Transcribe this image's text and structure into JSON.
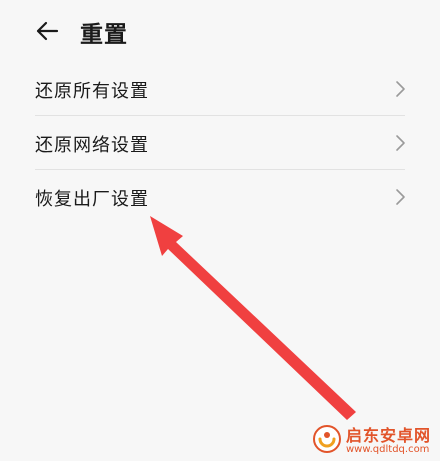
{
  "header": {
    "title": "重置",
    "back_icon": "arrow-left-icon"
  },
  "settings": {
    "items": [
      {
        "label": "还原所有设置",
        "icon": "chevron-right-icon"
      },
      {
        "label": "还原网络设置",
        "icon": "chevron-right-icon"
      },
      {
        "label": "恢复出厂设置",
        "icon": "chevron-right-icon"
      }
    ]
  },
  "annotation": {
    "arrow_color": "#f04040",
    "points_to": "恢复出厂设置"
  },
  "watermark": {
    "title": "启东安卓网",
    "url": "www.qdltdq.com",
    "color": "#e2542a"
  }
}
